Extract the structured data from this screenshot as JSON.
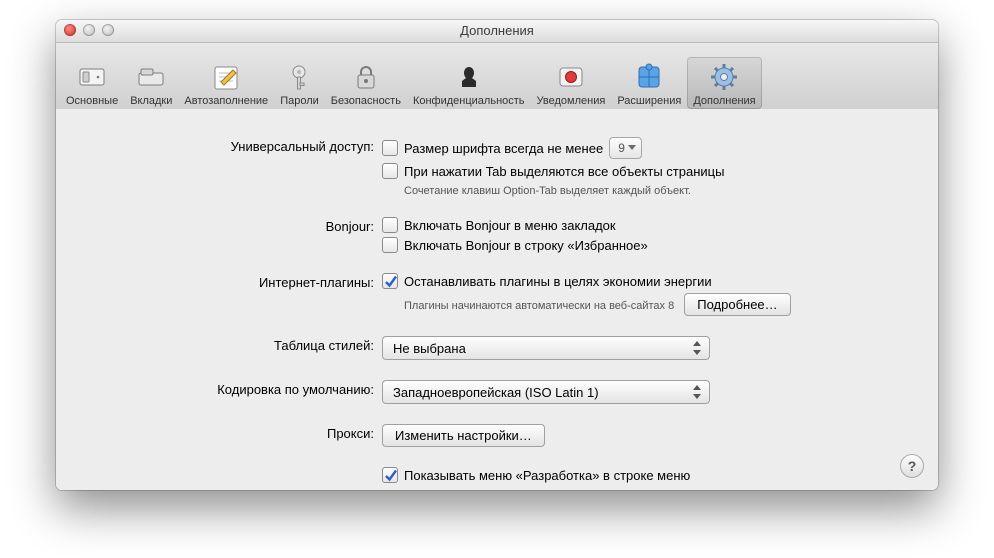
{
  "window": {
    "title": "Дополнения"
  },
  "toolbar": [
    {
      "label": "Основные"
    },
    {
      "label": "Вкладки"
    },
    {
      "label": "Автозаполнение"
    },
    {
      "label": "Пароли"
    },
    {
      "label": "Безопасность"
    },
    {
      "label": "Конфиденциальность"
    },
    {
      "label": "Уведомления"
    },
    {
      "label": "Расширения"
    },
    {
      "label": "Дополнения"
    }
  ],
  "sections": {
    "accessibility": {
      "label": "Универсальный доступ:",
      "min_font_label": "Размер шрифта всегда не менее",
      "min_font_value": "9",
      "tab_highlight_label": "При нажатии Tab выделяются все объекты страницы",
      "tab_hint": "Сочетание клавиш Option-Tab выделяет каждый объект."
    },
    "bonjour": {
      "label": "Bonjour:",
      "bookmarks_label": "Включать Bonjour в меню закладок",
      "favorites_label": "Включать Bonjour в строку «Избранное»"
    },
    "plugins": {
      "label": "Интернет-плагины:",
      "stop_label": "Останавливать плагины в целях экономии энергии",
      "hint": "Плагины начинаются автоматически на веб-сайтах 8",
      "details_btn": "Подробнее…"
    },
    "stylesheet": {
      "label": "Таблица стилей:",
      "value": "Не выбрана"
    },
    "encoding": {
      "label": "Кодировка по умолчанию:",
      "value": "Западноевропейская (ISO Latin 1)"
    },
    "proxies": {
      "label": "Прокси:",
      "button": "Изменить настройки…"
    },
    "develop": {
      "label": "Показывать меню «Разработка» в строке меню"
    }
  }
}
